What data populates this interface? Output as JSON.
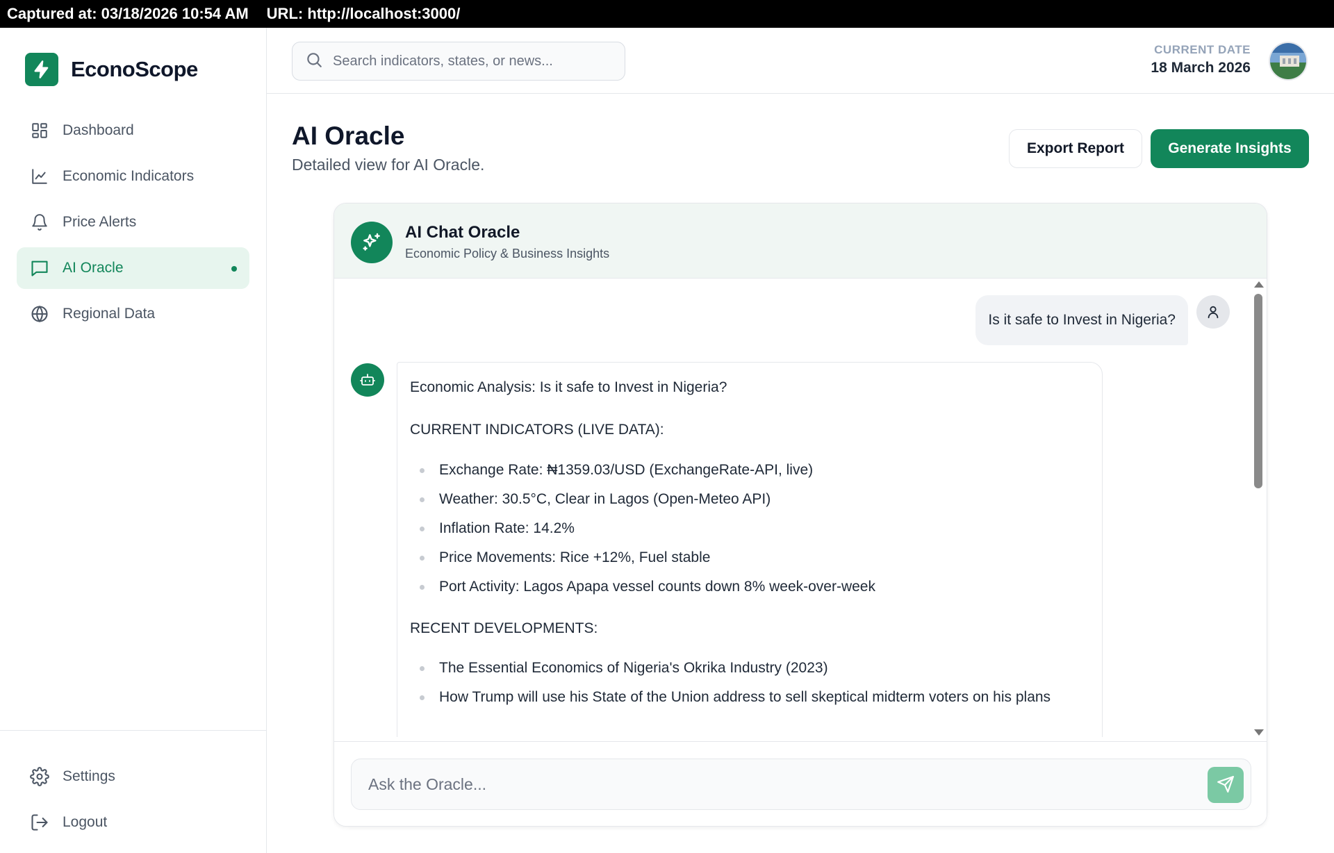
{
  "capture": {
    "captured": "Captured at: 03/18/2026 10:54 AM",
    "url": "URL: http://localhost:3000/"
  },
  "brand": {
    "name": "EconoScope",
    "accent": "#12865a"
  },
  "sidebar": {
    "items": [
      {
        "label": "Dashboard",
        "icon": "grid-icon"
      },
      {
        "label": "Economic Indicators",
        "icon": "line-chart-icon"
      },
      {
        "label": "Price Alerts",
        "icon": "bell-icon"
      },
      {
        "label": "AI Oracle",
        "icon": "message-square-icon",
        "active": true
      },
      {
        "label": "Regional Data",
        "icon": "globe-icon"
      }
    ],
    "bottom": [
      {
        "label": "Settings",
        "icon": "gear-icon"
      },
      {
        "label": "Logout",
        "icon": "logout-icon"
      }
    ]
  },
  "header": {
    "search_placeholder": "Search indicators, states, or news...",
    "date_label": "CURRENT DATE",
    "date_value": "18 March 2026"
  },
  "page": {
    "title": "AI Oracle",
    "subtitle": "Detailed view for AI Oracle.",
    "export_label": "Export Report",
    "generate_label": "Generate Insights"
  },
  "chat": {
    "title": "AI Chat Oracle",
    "subtitle": "Economic Policy & Business Insights",
    "user_message": "Is it safe to Invest in Nigeria?",
    "response": {
      "heading": "Economic Analysis: Is it safe to Invest in Nigeria?",
      "section1": "CURRENT INDICATORS (LIVE DATA):",
      "indicators": [
        "Exchange Rate: ₦1359.03/USD (ExchangeRate-API, live)",
        "Weather: 30.5°C, Clear in Lagos (Open-Meteo API)",
        "Inflation Rate: 14.2%",
        "Price Movements: Rice +12%, Fuel stable",
        "Port Activity: Lagos Apapa vessel counts down 8% week-over-week"
      ],
      "section2": "RECENT DEVELOPMENTS:",
      "developments": [
        "The Essential Economics of Nigeria's Okrika Industry (2023)",
        "How Trump will use his State of the Union address to sell skeptical midterm voters on his plans"
      ]
    },
    "input_placeholder": "Ask the Oracle..."
  }
}
